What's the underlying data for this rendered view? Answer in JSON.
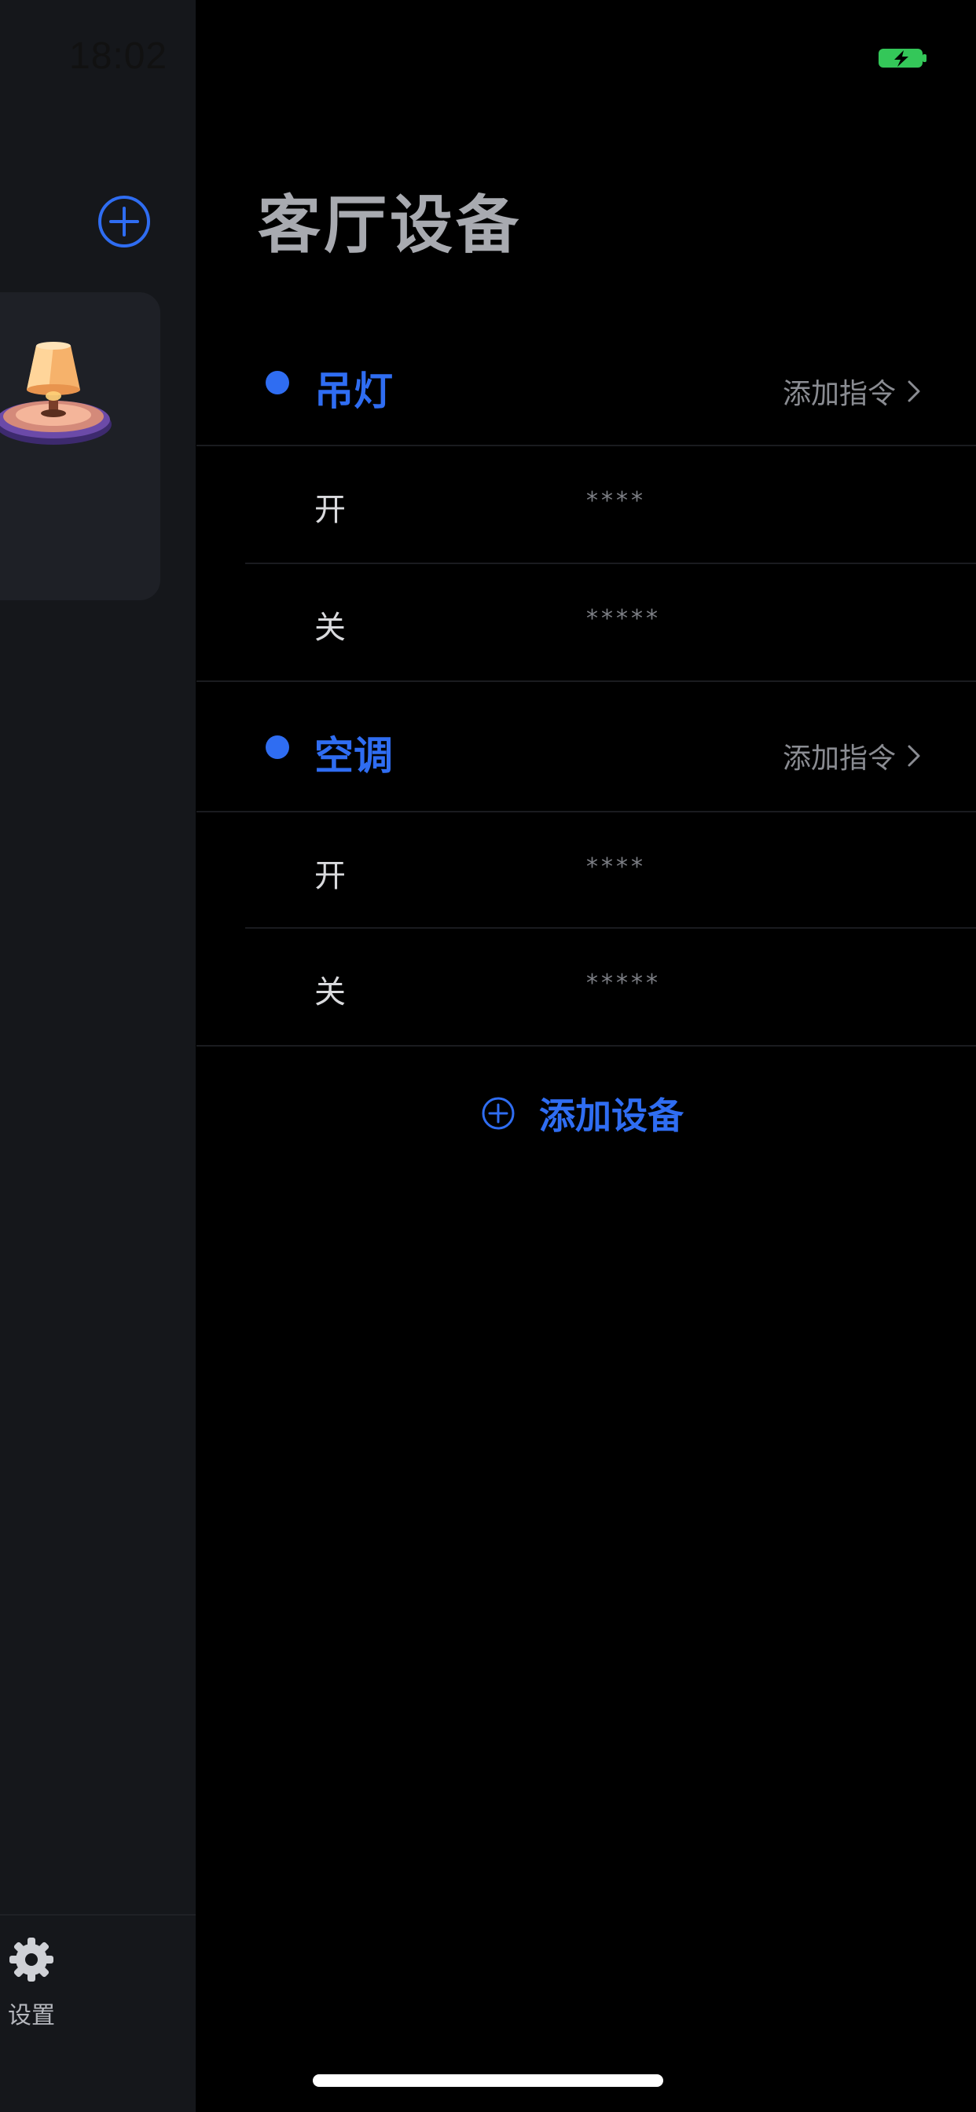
{
  "status_bar": {
    "time": "18:02",
    "battery_icon": "battery-charging-icon"
  },
  "drawer": {
    "add_icon": "plus-circle-icon",
    "room_card": {
      "image": "lamp-illustration"
    },
    "settings": {
      "icon": "gear-icon",
      "label": "设置"
    }
  },
  "main": {
    "title": "客厅设备",
    "devices": [
      {
        "name": "吊灯",
        "add_command_label": "添加指令",
        "commands": [
          {
            "name": "开",
            "code": "****"
          },
          {
            "name": "关",
            "code": "*****"
          }
        ]
      },
      {
        "name": "空调",
        "add_command_label": "添加指令",
        "commands": [
          {
            "name": "开",
            "code": "****"
          },
          {
            "name": "关",
            "code": "*****"
          }
        ]
      }
    ],
    "add_device_label": "添加设备"
  },
  "colors": {
    "accent": "#2f6df2",
    "background": "#000000",
    "drawer_background": "#15171b",
    "battery": "#34c759"
  }
}
